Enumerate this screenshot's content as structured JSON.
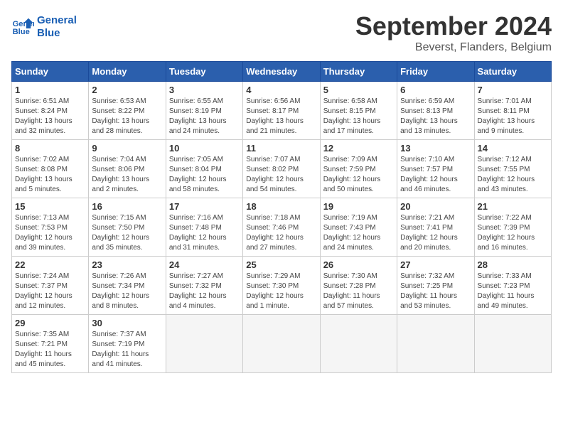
{
  "header": {
    "logo_line1": "General",
    "logo_line2": "Blue",
    "month": "September 2024",
    "location": "Beverst, Flanders, Belgium"
  },
  "weekdays": [
    "Sunday",
    "Monday",
    "Tuesday",
    "Wednesday",
    "Thursday",
    "Friday",
    "Saturday"
  ],
  "weeks": [
    [
      {
        "day": "1",
        "info": "Sunrise: 6:51 AM\nSunset: 8:24 PM\nDaylight: 13 hours\nand 32 minutes."
      },
      {
        "day": "2",
        "info": "Sunrise: 6:53 AM\nSunset: 8:22 PM\nDaylight: 13 hours\nand 28 minutes."
      },
      {
        "day": "3",
        "info": "Sunrise: 6:55 AM\nSunset: 8:19 PM\nDaylight: 13 hours\nand 24 minutes."
      },
      {
        "day": "4",
        "info": "Sunrise: 6:56 AM\nSunset: 8:17 PM\nDaylight: 13 hours\nand 21 minutes."
      },
      {
        "day": "5",
        "info": "Sunrise: 6:58 AM\nSunset: 8:15 PM\nDaylight: 13 hours\nand 17 minutes."
      },
      {
        "day": "6",
        "info": "Sunrise: 6:59 AM\nSunset: 8:13 PM\nDaylight: 13 hours\nand 13 minutes."
      },
      {
        "day": "7",
        "info": "Sunrise: 7:01 AM\nSunset: 8:11 PM\nDaylight: 13 hours\nand 9 minutes."
      }
    ],
    [
      {
        "day": "8",
        "info": "Sunrise: 7:02 AM\nSunset: 8:08 PM\nDaylight: 13 hours\nand 5 minutes."
      },
      {
        "day": "9",
        "info": "Sunrise: 7:04 AM\nSunset: 8:06 PM\nDaylight: 13 hours\nand 2 minutes."
      },
      {
        "day": "10",
        "info": "Sunrise: 7:05 AM\nSunset: 8:04 PM\nDaylight: 12 hours\nand 58 minutes."
      },
      {
        "day": "11",
        "info": "Sunrise: 7:07 AM\nSunset: 8:02 PM\nDaylight: 12 hours\nand 54 minutes."
      },
      {
        "day": "12",
        "info": "Sunrise: 7:09 AM\nSunset: 7:59 PM\nDaylight: 12 hours\nand 50 minutes."
      },
      {
        "day": "13",
        "info": "Sunrise: 7:10 AM\nSunset: 7:57 PM\nDaylight: 12 hours\nand 46 minutes."
      },
      {
        "day": "14",
        "info": "Sunrise: 7:12 AM\nSunset: 7:55 PM\nDaylight: 12 hours\nand 43 minutes."
      }
    ],
    [
      {
        "day": "15",
        "info": "Sunrise: 7:13 AM\nSunset: 7:53 PM\nDaylight: 12 hours\nand 39 minutes."
      },
      {
        "day": "16",
        "info": "Sunrise: 7:15 AM\nSunset: 7:50 PM\nDaylight: 12 hours\nand 35 minutes."
      },
      {
        "day": "17",
        "info": "Sunrise: 7:16 AM\nSunset: 7:48 PM\nDaylight: 12 hours\nand 31 minutes."
      },
      {
        "day": "18",
        "info": "Sunrise: 7:18 AM\nSunset: 7:46 PM\nDaylight: 12 hours\nand 27 minutes."
      },
      {
        "day": "19",
        "info": "Sunrise: 7:19 AM\nSunset: 7:43 PM\nDaylight: 12 hours\nand 24 minutes."
      },
      {
        "day": "20",
        "info": "Sunrise: 7:21 AM\nSunset: 7:41 PM\nDaylight: 12 hours\nand 20 minutes."
      },
      {
        "day": "21",
        "info": "Sunrise: 7:22 AM\nSunset: 7:39 PM\nDaylight: 12 hours\nand 16 minutes."
      }
    ],
    [
      {
        "day": "22",
        "info": "Sunrise: 7:24 AM\nSunset: 7:37 PM\nDaylight: 12 hours\nand 12 minutes."
      },
      {
        "day": "23",
        "info": "Sunrise: 7:26 AM\nSunset: 7:34 PM\nDaylight: 12 hours\nand 8 minutes."
      },
      {
        "day": "24",
        "info": "Sunrise: 7:27 AM\nSunset: 7:32 PM\nDaylight: 12 hours\nand 4 minutes."
      },
      {
        "day": "25",
        "info": "Sunrise: 7:29 AM\nSunset: 7:30 PM\nDaylight: 12 hours\nand 1 minute."
      },
      {
        "day": "26",
        "info": "Sunrise: 7:30 AM\nSunset: 7:28 PM\nDaylight: 11 hours\nand 57 minutes."
      },
      {
        "day": "27",
        "info": "Sunrise: 7:32 AM\nSunset: 7:25 PM\nDaylight: 11 hours\nand 53 minutes."
      },
      {
        "day": "28",
        "info": "Sunrise: 7:33 AM\nSunset: 7:23 PM\nDaylight: 11 hours\nand 49 minutes."
      }
    ],
    [
      {
        "day": "29",
        "info": "Sunrise: 7:35 AM\nSunset: 7:21 PM\nDaylight: 11 hours\nand 45 minutes."
      },
      {
        "day": "30",
        "info": "Sunrise: 7:37 AM\nSunset: 7:19 PM\nDaylight: 11 hours\nand 41 minutes."
      },
      {
        "day": "",
        "info": ""
      },
      {
        "day": "",
        "info": ""
      },
      {
        "day": "",
        "info": ""
      },
      {
        "day": "",
        "info": ""
      },
      {
        "day": "",
        "info": ""
      }
    ]
  ]
}
